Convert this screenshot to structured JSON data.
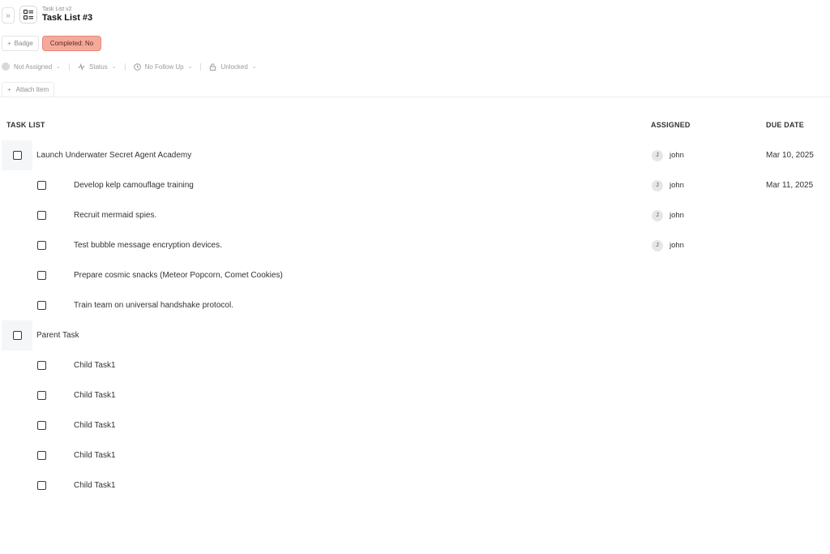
{
  "header": {
    "breadcrumb": "Task List v2",
    "title": "Task List #3"
  },
  "badges": {
    "add_label": "Badge",
    "completed_label": "Completed: No"
  },
  "properties": {
    "assignee": "Not Assigned",
    "status": "Status",
    "follow_up": "No Follow Up",
    "lock": "Unlocked"
  },
  "attach": {
    "label": "Attach Item"
  },
  "table": {
    "headers": {
      "task": "TASK LIST",
      "assigned": "ASSIGNED",
      "due": "DUE DATE"
    },
    "rows": [
      {
        "level": "parent",
        "label": "Launch Underwater Secret Agent Academy",
        "assignee_initial": "J",
        "assignee": "john",
        "due": "Mar 10, 2025"
      },
      {
        "level": "child",
        "label": "Develop kelp camouflage training",
        "assignee_initial": "J",
        "assignee": "john",
        "due": "Mar 11, 2025"
      },
      {
        "level": "child",
        "label": "Recruit mermaid spies.",
        "assignee_initial": "J",
        "assignee": "john",
        "due": ""
      },
      {
        "level": "child",
        "label": "Test bubble message encryption devices.",
        "assignee_initial": "J",
        "assignee": "john",
        "due": ""
      },
      {
        "level": "child",
        "label": "Prepare cosmic snacks (Meteor Popcorn, Comet Cookies)",
        "assignee_initial": "",
        "assignee": "",
        "due": ""
      },
      {
        "level": "child",
        "label": "Train team on universal handshake protocol.",
        "assignee_initial": "",
        "assignee": "",
        "due": ""
      },
      {
        "level": "parent",
        "label": "Parent Task",
        "assignee_initial": "",
        "assignee": "",
        "due": ""
      },
      {
        "level": "child",
        "label": "Child Task1",
        "assignee_initial": "",
        "assignee": "",
        "due": ""
      },
      {
        "level": "child",
        "label": "Child Task1",
        "assignee_initial": "",
        "assignee": "",
        "due": ""
      },
      {
        "level": "child",
        "label": "Child Task1",
        "assignee_initial": "",
        "assignee": "",
        "due": ""
      },
      {
        "level": "child",
        "label": "Child Task1",
        "assignee_initial": "",
        "assignee": "",
        "due": ""
      },
      {
        "level": "child",
        "label": "Child Task1",
        "assignee_initial": "",
        "assignee": "",
        "due": ""
      }
    ]
  }
}
